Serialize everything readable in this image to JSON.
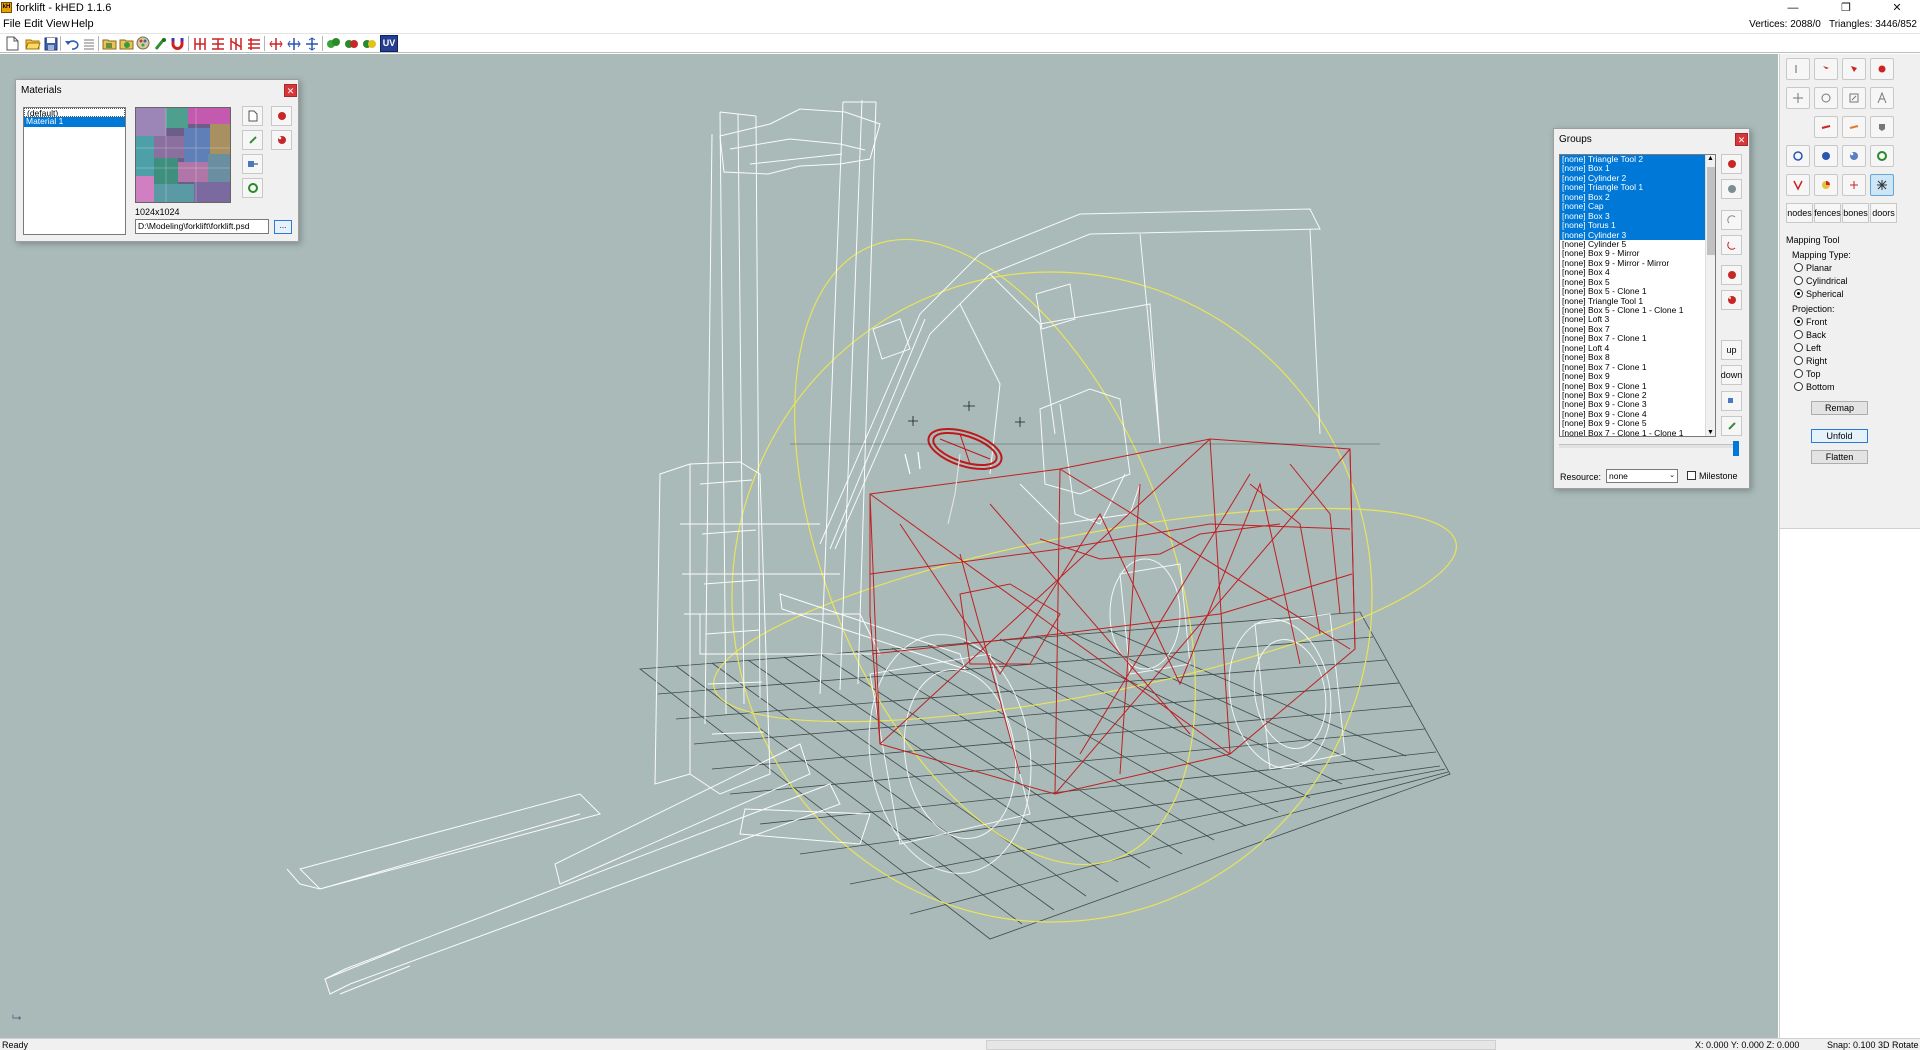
{
  "window": {
    "app_icon": "kH",
    "title": "forklift - kHED 1.1.6",
    "controls": [
      "—",
      "❐",
      "✕"
    ]
  },
  "menu": {
    "items": [
      "File",
      "Edit",
      "View",
      "Help"
    ]
  },
  "stats": {
    "vertices_label": "Vertices: 2088/0",
    "triangles_label": "Triangles: 3446/852"
  },
  "toolbar": {
    "icons": [
      "new-file-icon",
      "open-folder-icon",
      "save-icon",
      "undo-icon",
      "redo-icon",
      "import-icon",
      "export-icon",
      "render-icon",
      "weld-icon",
      "magnet-icon",
      "flip-x-icon",
      "flip-y-icon",
      "flip-z-icon",
      "mirror-icon",
      "align-x-icon",
      "align-y-icon",
      "align-z-icon",
      "green-sphere-icon",
      "red-sphere-icon",
      "yellow-sphere-icon",
      "uv-icon"
    ],
    "uv_label": "UV"
  },
  "materials": {
    "title": "Materials",
    "items": [
      {
        "label": "(default)",
        "selected": false
      },
      {
        "label": "Material 1",
        "selected": true
      }
    ],
    "texture_size": "1024x1024",
    "texture_path": "D:\\Modeling\\forklift\\forklift.psd",
    "browse_label": "...",
    "close_label": "✕"
  },
  "groups": {
    "title": "Groups",
    "close_label": "✕",
    "items": [
      {
        "label": "[none] Triangle Tool 2",
        "selected": true
      },
      {
        "label": "[none] Box 1",
        "selected": true
      },
      {
        "label": "[none] Cylinder 2",
        "selected": true
      },
      {
        "label": "[none] Triangle Tool 1",
        "selected": true
      },
      {
        "label": "[none] Box 2",
        "selected": true
      },
      {
        "label": "[none] Cap",
        "selected": true
      },
      {
        "label": "[none] Box 3",
        "selected": true
      },
      {
        "label": "[none] Torus 1",
        "selected": true
      },
      {
        "label": "[none] Cylinder 3",
        "selected": true
      },
      {
        "label": "[none] Cylinder 5",
        "selected": false
      },
      {
        "label": "[none] Box 9 - Mirror",
        "selected": false
      },
      {
        "label": "[none] Box 9 - Mirror - Mirror",
        "selected": false
      },
      {
        "label": "[none] Box 4",
        "selected": false
      },
      {
        "label": "[none] Box 5",
        "selected": false
      },
      {
        "label": "[none] Box 5 - Clone 1",
        "selected": false
      },
      {
        "label": "[none] Triangle Tool 1",
        "selected": false
      },
      {
        "label": "[none] Box 5 - Clone 1 - Clone 1",
        "selected": false
      },
      {
        "label": "[none] Loft 3",
        "selected": false
      },
      {
        "label": "[none] Box 7",
        "selected": false
      },
      {
        "label": "[none] Box 7 - Clone 1",
        "selected": false
      },
      {
        "label": "[none] Loft 4",
        "selected": false
      },
      {
        "label": "[none] Box 8",
        "selected": false
      },
      {
        "label": "[none] Box 7 - Clone 1",
        "selected": false
      },
      {
        "label": "[none] Box 9",
        "selected": false
      },
      {
        "label": "[none] Box 9 - Clone 1",
        "selected": false
      },
      {
        "label": "[none] Box 9 - Clone 2",
        "selected": false
      },
      {
        "label": "[none] Box 9 - Clone 3",
        "selected": false
      },
      {
        "label": "[none] Box 9 - Clone 4",
        "selected": false
      },
      {
        "label": "[none] Box 9 - Clone 5",
        "selected": false
      },
      {
        "label": "[none] Box 7 - Clone 1 - Clone 1",
        "selected": false
      }
    ],
    "up_label": "up",
    "down_label": "down",
    "resource_label": "Resource:",
    "resource_value": "none",
    "milestone_label": "Milestone"
  },
  "right_panel": {
    "tabs": [
      "nodes",
      "fences",
      "bones",
      "doors"
    ],
    "mapping_tool_label": "Mapping Tool",
    "mapping_type_label": "Mapping Type:",
    "mapping_types": [
      {
        "label": "Planar",
        "checked": false
      },
      {
        "label": "Cylindrical",
        "checked": false
      },
      {
        "label": "Spherical",
        "checked": true
      }
    ],
    "projection_label": "Projection:",
    "projections": [
      {
        "label": "Front",
        "checked": true
      },
      {
        "label": "Back",
        "checked": false
      },
      {
        "label": "Left",
        "checked": false
      },
      {
        "label": "Right",
        "checked": false
      },
      {
        "label": "Top",
        "checked": false
      },
      {
        "label": "Bottom",
        "checked": false
      }
    ],
    "remap_label": "Remap",
    "unfold_label": "Unfold",
    "flatten_label": "Flatten"
  },
  "status": {
    "left": "Ready",
    "coords": "X: 0.000 Y: 0.000 Z: 0.000",
    "snap": "Snap: 0.100 3D Rotate"
  },
  "colors": {
    "viewport_bg": "#a9bab9",
    "wire_white": "#ffffff",
    "wire_selected": "#c0181a",
    "grid": "#2c3736",
    "gizmo": "#e9e35a",
    "list_selection": "#0078d7"
  }
}
